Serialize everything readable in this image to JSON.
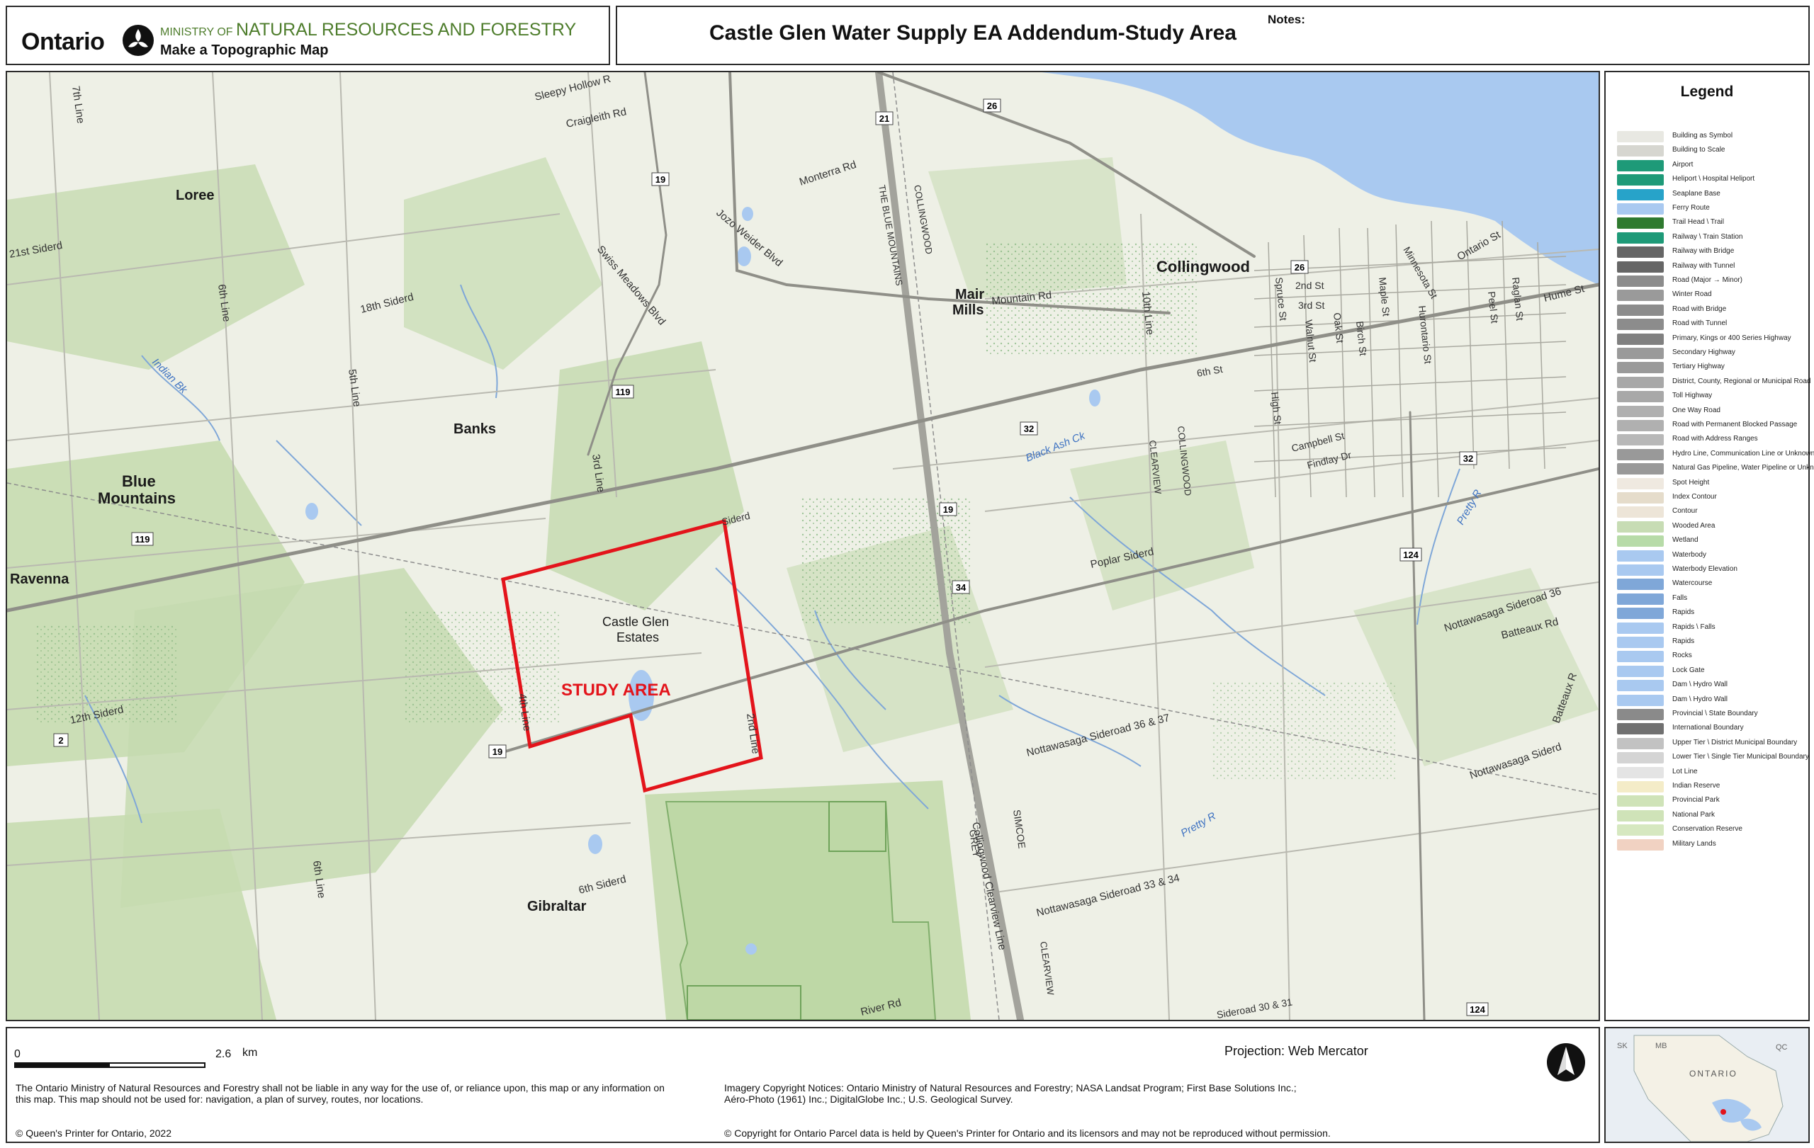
{
  "header": {
    "ontario_wordmark": "Ontario",
    "ministry_prefix": "MINISTRY OF",
    "ministry_name": "NATURAL RESOURCES AND FORESTRY",
    "app_subtitle": "Make a Topographic Map",
    "map_title": "Castle Glen Water Supply EA Addendum-Study Area",
    "notes_label": "Notes:"
  },
  "map": {
    "study_area_label": "STUDY AREA",
    "places": {
      "loree": "Loree",
      "banks": "Banks",
      "blue_mountains_1": "Blue",
      "blue_mountains_2": "Mountains",
      "ravenna": "Ravenna",
      "gibraltar": "Gibraltar",
      "mair_mills_1": "Mair",
      "mair_mills_2": "Mills",
      "collingwood": "Collingwood",
      "castle_glen_1": "Castle Glen",
      "castle_glen_2": "Estates"
    },
    "roads": {
      "sleepy_hollow": "Sleepy Hollow R",
      "craigleith": "Craigleith Rd",
      "monterra": "Monterra Rd",
      "jozo_weider": "Jozo Weider Blvd",
      "swiss_meadows": "Swiss Meadows Blvd",
      "the_blue_mountains": "THE BLUE MOUNTAINS",
      "collingwood_boundary": "COLLINGWOOD",
      "sideroad_21": "21st Siderd",
      "sideroad_18": "18th Siderd",
      "sideroad_12": "12th Siderd",
      "sideroad_6": "6th Siderd",
      "line_7": "7th Line",
      "line_6": "6th Line",
      "line_5": "5th Line",
      "line_3": "3rd Line",
      "line_4": "4th Line",
      "line_2": "2nd Line",
      "line_6b": "6th Line",
      "line_10": "10th Line",
      "mountain_rd": "Mountain Rd",
      "poplar_siderd": "Poplar Siderd",
      "nottawasaga_36_37": "Nottawasaga Sideroad 36 & 37",
      "nottawasaga_33_34": "Nottawasaga Sideroad 33 & 34",
      "nottawasaga_36": "Nottawasaga Sideroad 36",
      "nottawasaga_e": "Nottawasaga Siderd",
      "batteaux": "Batteaux Rd",
      "batteaux_r": "Batteaux R",
      "clearview_line": "Collingwood Clearview Line",
      "grey": "GREY",
      "simcoe": "SIMCOE",
      "clearview": "CLEARVIEW",
      "collingwood_2": "COLLINGWOOD",
      "clearview_2": "CLEARVIEW",
      "river_rd": "River Rd",
      "ontario_st": "Ontario St",
      "hume_st": "Hume St",
      "spruce_st": "Spruce St",
      "second_st": "2nd St",
      "third_st": "3rd St",
      "walnut_st": "Walnut St",
      "oak_st": "Oak St",
      "birch_st": "Birch St",
      "maple_st": "Maple St",
      "hurontario_st": "Hurontario St",
      "minnesota_st": "Minnesota St",
      "peel_st": "Peel St",
      "raglan_st": "Raglan St",
      "sixth_st": "6th St",
      "high_st": "High St",
      "campbell_st": "Campbell St",
      "findlay_dr": "Findlay Dr",
      "siderd_label": "Siderd",
      "road_30_31": "Sideroad 30 & 31"
    },
    "water": {
      "indian_bk": "Indian Bk",
      "black_ash_ck": "Black Ash Ck",
      "pretty_r": "Pretty R",
      "pretty_r2": "Pretty R"
    },
    "shields": [
      "21",
      "26",
      "19",
      "119",
      "119",
      "119",
      "32",
      "19",
      "34",
      "19",
      "2",
      "124",
      "32",
      "26",
      "124"
    ]
  },
  "legend": {
    "title": "Legend",
    "items": [
      {
        "label": "Building as Symbol",
        "color": "#e8e8e2"
      },
      {
        "label": "Building to Scale",
        "color": "#d6d6d0"
      },
      {
        "label": "Airport",
        "color": "#1e9a78"
      },
      {
        "label": "Heliport \\ Hospital Heliport",
        "color": "#1e9a78"
      },
      {
        "label": "Seaplane Base",
        "color": "#27a3c9"
      },
      {
        "label": "Ferry Route",
        "color": "#a9c9f0"
      },
      {
        "label": "Trail Head \\ Trail",
        "color": "#2f7a2f"
      },
      {
        "label": "Railway \\ Train Station",
        "color": "#1e9a78"
      },
      {
        "label": "Railway with Bridge",
        "color": "#666666"
      },
      {
        "label": "Railway with Tunnel",
        "color": "#666666"
      },
      {
        "label": "Road (Major → Minor)",
        "color": "#8c8c8c"
      },
      {
        "label": "Winter Road",
        "color": "#9a9a9a"
      },
      {
        "label": "Road with Bridge",
        "color": "#8c8c8c"
      },
      {
        "label": "Road with Tunnel",
        "color": "#8c8c8c"
      },
      {
        "label": "Primary, Kings or 400 Series Highway",
        "color": "#808080"
      },
      {
        "label": "Secondary Highway",
        "color": "#9a9a9a"
      },
      {
        "label": "Tertiary Highway",
        "color": "#9a9a9a"
      },
      {
        "label": "District, County, Regional or Municipal Road",
        "color": "#a8a8a8"
      },
      {
        "label": "Toll Highway",
        "color": "#a8a8a8"
      },
      {
        "label": "One Way Road",
        "color": "#b0b0b0"
      },
      {
        "label": "Road with Permanent Blocked Passage",
        "color": "#b0b0b0"
      },
      {
        "label": "Road with Address Ranges",
        "color": "#b8b8b8"
      },
      {
        "label": "Hydro Line, Communication Line or Unknown Transmission Line",
        "color": "#999999"
      },
      {
        "label": "Natural Gas Pipeline, Water Pipeline or Unknown Pipeline",
        "color": "#999999"
      },
      {
        "label": "Spot Height",
        "color": "#efe9e0"
      },
      {
        "label": "Index Contour",
        "color": "#e5dccb"
      },
      {
        "label": "Contour",
        "color": "#ede5d8"
      },
      {
        "label": "Wooded Area",
        "color": "#c7dcb4"
      },
      {
        "label": "Wetland",
        "color": "#b7dba8"
      },
      {
        "label": "Waterbody",
        "color": "#a9c9f0"
      },
      {
        "label": "Waterbody Elevation",
        "color": "#a9c9f0"
      },
      {
        "label": "Watercourse",
        "color": "#7fa7d8"
      },
      {
        "label": "Falls",
        "color": "#7fa7d8"
      },
      {
        "label": "Rapids",
        "color": "#7fa7d8"
      },
      {
        "label": "Rapids \\ Falls",
        "color": "#a9c9f0"
      },
      {
        "label": "Rapids",
        "color": "#a9c9f0"
      },
      {
        "label": "Rocks",
        "color": "#a9c9f0"
      },
      {
        "label": "Lock Gate",
        "color": "#a9c9f0"
      },
      {
        "label": "Dam \\ Hydro Wall",
        "color": "#a9c9f0"
      },
      {
        "label": "Dam \\ Hydro Wall",
        "color": "#a9c9f0"
      },
      {
        "label": "Provincial \\ State Boundary",
        "color": "#8a8a8a"
      },
      {
        "label": "International Boundary",
        "color": "#707070"
      },
      {
        "label": "Upper Tier \\ District Municipal Boundary",
        "color": "#c2c2c2"
      },
      {
        "label": "Lower Tier \\ Single Tier Municipal Boundary",
        "color": "#d4d4d4"
      },
      {
        "label": "Lot Line",
        "color": "#e4e4e4"
      },
      {
        "label": "Indian Reserve",
        "color": "#f4ecc8"
      },
      {
        "label": "Provincial Park",
        "color": "#cfe3b8"
      },
      {
        "label": "National Park",
        "color": "#cfe3b8"
      },
      {
        "label": "Conservation Reserve",
        "color": "#d6e8c0"
      },
      {
        "label": "Military Lands",
        "color": "#f1d2c2"
      }
    ]
  },
  "footer": {
    "scale_zero": "0",
    "scale_value": "2.6",
    "scale_unit": "km",
    "projection": "Projection: Web Mercator",
    "disclaimer": "The Ontario Ministry of Natural Resources and Forestry shall not be liable in any way for the use of, or reliance upon, this map or any information on this map.  This map should not be used for: navigation, a plan of survey, routes, nor locations.",
    "imagery_notice": "Imagery Copyright Notices: Ontario Ministry of Natural Resources and Forestry; NASA Landsat Program; First Base Solutions Inc.; Aéro-Photo (1961) Inc.; DigitalGlobe Inc.; U.S. Geological Survey.",
    "queens_printer": "© Queen's Printer for Ontario, 2022",
    "parcel_copyright": "© Copyright for Ontario Parcel data is held by Queen's Printer for Ontario and its licensors and may not be reproduced without permission."
  },
  "inset": {
    "province_label": "ONTARIO",
    "label_sk": "SK",
    "label_mb": "MB",
    "label_qc": "QC"
  },
  "colors": {
    "ministry_green": "#4e7d2c",
    "study_area_red": "#e3141b",
    "water_blue": "#a9c9f0",
    "map_base": "#eef0e6",
    "forest_green": "#b9d3a0"
  }
}
